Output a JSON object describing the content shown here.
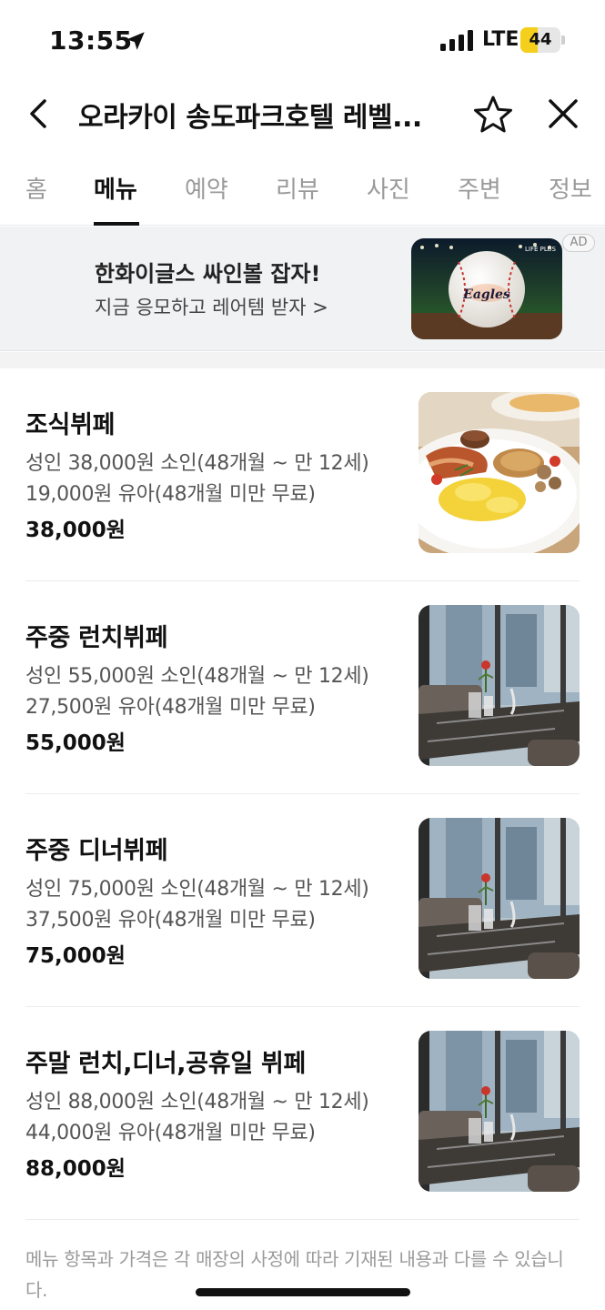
{
  "status_bar": {
    "time": "13:55",
    "network": "LTE",
    "battery_level": "44",
    "battery_fraction": 0.44,
    "icons": [
      "location-arrow-icon",
      "signal-icon",
      "battery-icon"
    ]
  },
  "header": {
    "title": "오라카이 송도파크호텔 레벨...",
    "icons": [
      "chevron-left-icon",
      "star-outline-icon",
      "close-icon"
    ]
  },
  "tabs": [
    {
      "label": "홈"
    },
    {
      "label": "메뉴",
      "active": true
    },
    {
      "label": "예약"
    },
    {
      "label": "리뷰"
    },
    {
      "label": "사진"
    },
    {
      "label": "주변"
    },
    {
      "label": "정보"
    }
  ],
  "ad": {
    "title": "한화이글스 싸인볼 잡자!",
    "subtitle": "지금 응모하고 레어템 받자 >",
    "badge": "AD",
    "image_brand": "LIFE PLUS",
    "ball_text": "Eagles"
  },
  "menu_items": [
    {
      "name": "조식뷔페",
      "desc_line1": "성인 38,000원 소인(48개월 ~ 만 12세)",
      "desc_line2": "19,000원 유아(48개월 미만 무료)",
      "price": "38,000원",
      "image": "breakfast-plate"
    },
    {
      "name": "주중 런치뷔페",
      "desc_line1": "성인 55,000원 소인(48개월 ~ 만 12세)",
      "desc_line2": "27,500원 유아(48개월 미만 무료)",
      "price": "55,000원",
      "image": "restaurant-table"
    },
    {
      "name": "주중 디너뷔페",
      "desc_line1": "성인 75,000원 소인(48개월 ~ 만 12세)",
      "desc_line2": "37,500원 유아(48개월 미만 무료)",
      "price": "75,000원",
      "image": "restaurant-table"
    },
    {
      "name": "주말 런치,디너,공휴일 뷔페",
      "desc_line1": "성인 88,000원 소인(48개월 ~ 만 12세)",
      "desc_line2": "44,000원 유아(48개월 미만 무료)",
      "price": "88,000원",
      "image": "restaurant-table"
    }
  ],
  "footer": {
    "note": "메뉴 항목과 가격은 각 매장의 사정에 따라 기재된 내용과 다를 수 있습니다."
  },
  "colors": {
    "accent": "#111111",
    "battery": "#f5cf1c",
    "ad_background": "#f1f2f4",
    "muted_text": "#9a9a9a"
  }
}
